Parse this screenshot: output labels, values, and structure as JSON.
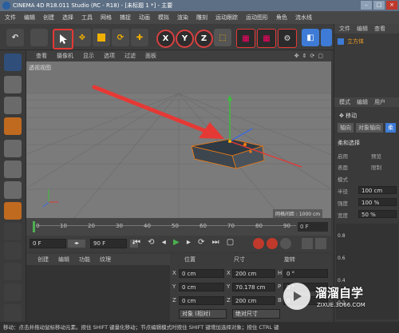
{
  "titlebar": {
    "title": "CINEMA 4D R18.011 Studio (RC - R18) - [未标题 1 *] - 主要"
  },
  "menu": [
    "文件",
    "编辑",
    "创建",
    "选择",
    "工具",
    "网格",
    "捕捉",
    "动画",
    "模拟",
    "渲染",
    "雕刻",
    "运动跟踪",
    "运动图形",
    "角色",
    "流水线",
    "插件",
    "脚本",
    "窗口",
    "帮助"
  ],
  "toolbar": {
    "x_label": "X",
    "y_label": "Y",
    "z_label": "Z"
  },
  "viewport": {
    "menu": [
      "查看",
      "摄像机",
      "显示",
      "选项",
      "过滤",
      "面板"
    ],
    "label": "透视视图",
    "grid_spacing": "网格间距 : 1000 cm"
  },
  "timeline": {
    "ticks": [
      "0",
      "10",
      "20",
      "30",
      "40",
      "50",
      "60",
      "70",
      "80",
      "90"
    ],
    "end_frame": "0 F"
  },
  "transport": {
    "start": "0 F",
    "end": "90 F"
  },
  "material": {
    "menu": [
      "创建",
      "编辑",
      "功能",
      "纹理"
    ]
  },
  "coords": {
    "headers": [
      "位置",
      "尺寸",
      "旋转"
    ],
    "rows": [
      {
        "axis": "X",
        "pos": "0 cm",
        "size": "200 cm",
        "rot_axis": "H",
        "rot": "0 °"
      },
      {
        "axis": "Y",
        "pos": "0 cm",
        "size": "70.178 cm",
        "rot_axis": "P",
        "rot": "0 °"
      },
      {
        "axis": "Z",
        "pos": "0 cm",
        "size": "200 cm",
        "rot_axis": "B",
        "rot": "0 °"
      }
    ],
    "mode_left": "对象 (相对)",
    "mode_right": "绝对尺寸"
  },
  "rightpanel": {
    "tabs": [
      "文件",
      "编辑",
      "查看"
    ],
    "object": "立方体",
    "attr_tabs": [
      "模式",
      "编辑",
      "用户"
    ],
    "tool_name": "移动",
    "subtabs": [
      "轴向",
      "对象轴向",
      "柔"
    ],
    "section": "柔和选择",
    "fields": [
      "启用",
      "预览",
      "表面",
      "限制",
      "模式",
      "半径",
      "强度",
      "宽度"
    ],
    "values": [
      "100 cm",
      "100 %",
      "50 %"
    ],
    "graph_labels": [
      "0.8",
      "0.6",
      "0.4",
      "0.2"
    ]
  },
  "status": "移动：点击并拖动鼠标移动元素。按住 SHIFT 键量化移动；节点编辑模式时按住 SHIFT 键增加选择对象；按住 CTRL 键",
  "watermark": {
    "brand": "溜溜自学",
    "url": "ZIXUE.3D66.COM"
  },
  "colors": {
    "accent_red": "#e53935",
    "axis_green": "#3bbf3b",
    "axis_blue": "#3a6be0",
    "selection_orange": "#f07a10"
  }
}
